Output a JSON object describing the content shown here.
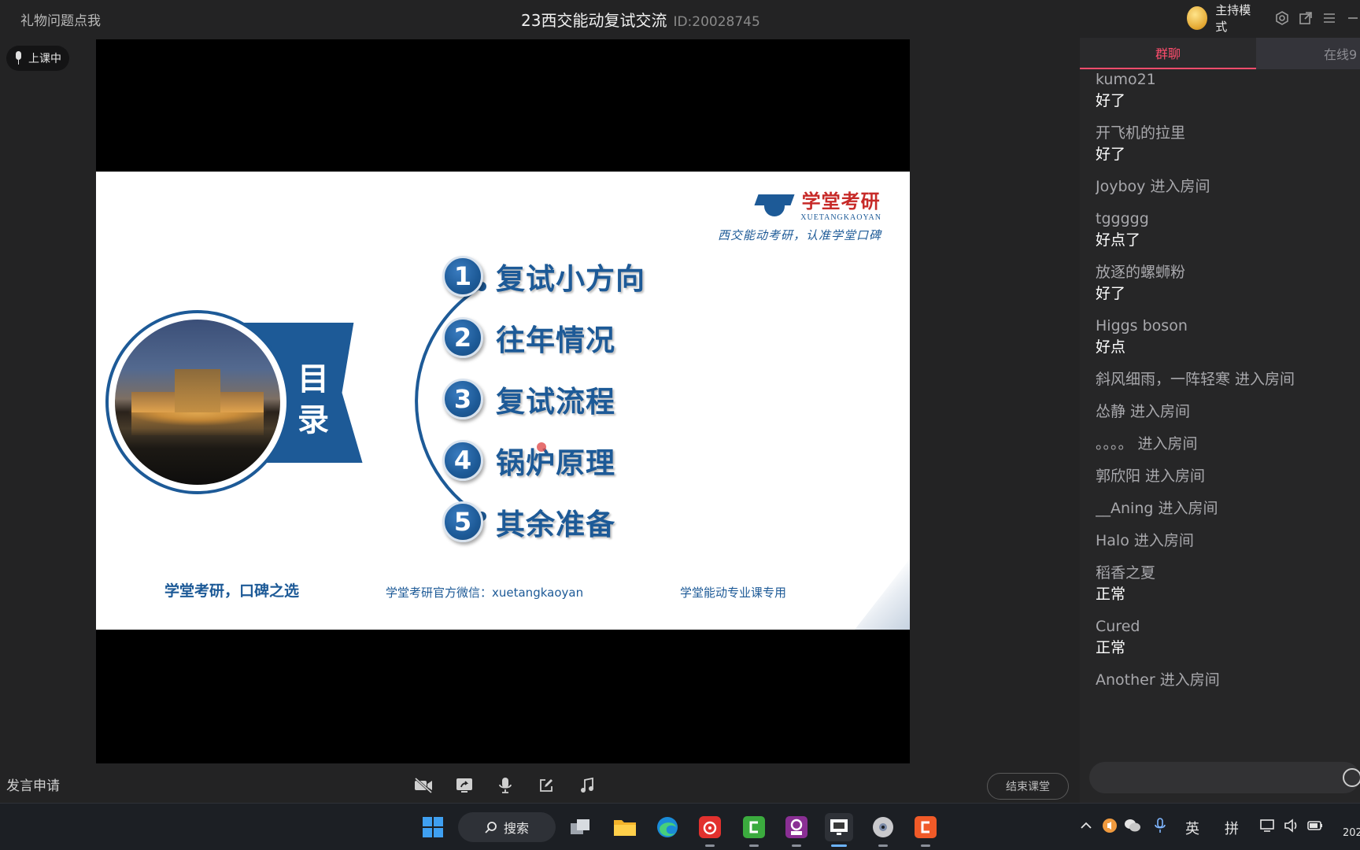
{
  "topbar": {
    "gift_link": "礼物问题点我",
    "title": "23西交能动复试交流",
    "room_id": "ID:20028745",
    "host_mode": "主持模式"
  },
  "status": {
    "label": "上课中"
  },
  "slide": {
    "logo_cn": "学堂考研",
    "logo_en": "XUETANGKAOYAN",
    "slogan": "西交能动考研，认准学堂口碑",
    "toc_title_1": "目",
    "toc_title_2": "录",
    "items": [
      {
        "num": "1",
        "label": "复试小方向"
      },
      {
        "num": "2",
        "label": "往年情况"
      },
      {
        "num": "3",
        "label": "复试流程"
      },
      {
        "num": "4",
        "label": "锅炉原理"
      },
      {
        "num": "5",
        "label": "其余准备"
      }
    ],
    "footer_left": "学堂考研，口碑之选",
    "footer_mid": "学堂考研官方微信：xuetangkaoyan",
    "footer_right": "学堂能动专业课专用"
  },
  "controls": {
    "speak_request": "发言申请",
    "end_class": "结束课堂"
  },
  "panel": {
    "tab_group": "群聊",
    "tab_online": "在线9",
    "messages": [
      {
        "who": "kumo21",
        "what": "好了"
      },
      {
        "who": "开飞机的拉里",
        "what": "好了"
      },
      {
        "who": "Joyboy 进入房间",
        "what": ""
      },
      {
        "who": "tggggg",
        "what": "好点了"
      },
      {
        "who": "放逐的螺蛳粉",
        "what": "好了"
      },
      {
        "who": "Higgs boson",
        "what": "好点"
      },
      {
        "who": "斜风细雨，一阵轻寒 进入房间",
        "what": ""
      },
      {
        "who": "怂静 进入房间",
        "what": ""
      },
      {
        "who": "。。。。 进入房间",
        "what": ""
      },
      {
        "who": "郭欣阳 进入房间",
        "what": ""
      },
      {
        "who": "__Aning 进入房间",
        "what": ""
      },
      {
        "who": "Halo 进入房间",
        "what": ""
      },
      {
        "who": "稻香之夏",
        "what": "正常"
      },
      {
        "who": "Cured",
        "what": "正常"
      },
      {
        "who": "Another 进入房间",
        "what": ""
      }
    ]
  },
  "taskbar": {
    "search_label": "搜索",
    "ime_lang": "英",
    "ime_mode": "拼",
    "clock_partial": "202"
  }
}
